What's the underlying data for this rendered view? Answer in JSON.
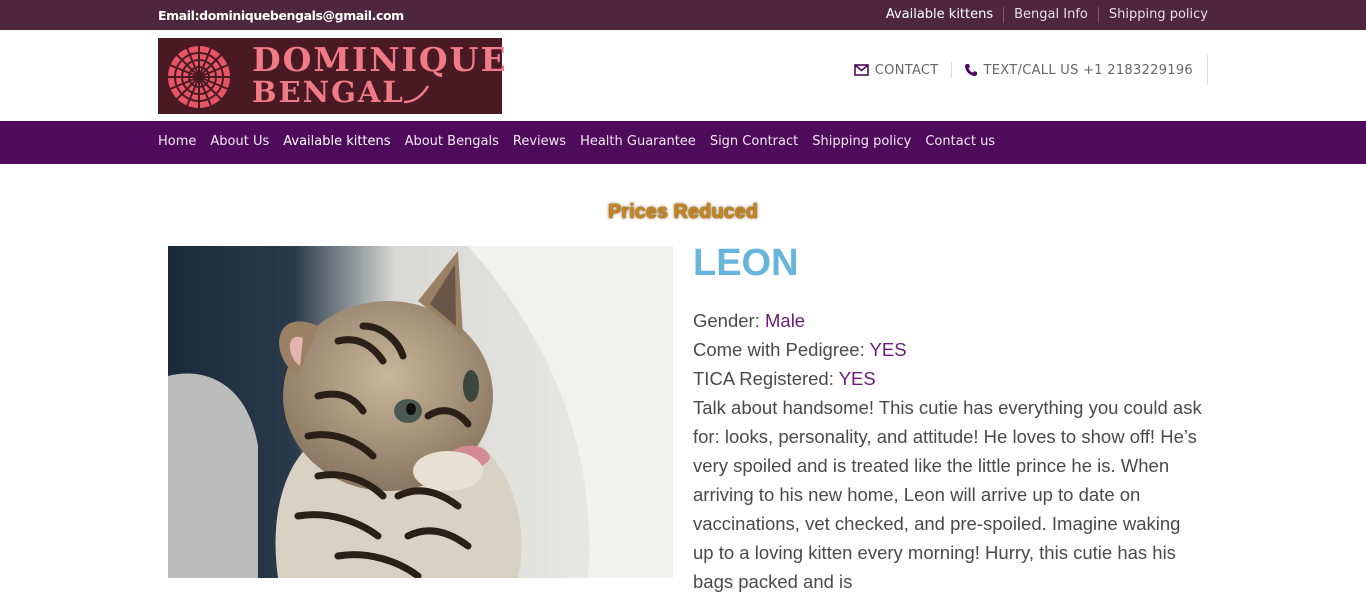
{
  "topbar": {
    "email": "Email:dominiquebengals@gmail.com",
    "links": [
      "Available kittens",
      "Bengal Info",
      "Shipping policy"
    ]
  },
  "logo": {
    "line1": "DOMINIQUE",
    "line2": "BENGAL"
  },
  "header": {
    "contact_label": "CONTACT",
    "call_label": "TEXT/CALL US +1 2183229196"
  },
  "nav": {
    "items": [
      "Home",
      "About Us",
      "Available kittens",
      "About Bengals",
      "Reviews",
      "Health Guarantee",
      "Sign Contract",
      "Shipping policy",
      "Contact us"
    ],
    "active": "Available kittens"
  },
  "main": {
    "banner": "Prices Reduced",
    "kitten_name": "LEON",
    "gender_label": "Gender:",
    "gender": "Male",
    "pedigree_label": "Come with Pedigree:",
    "pedigree": "YES",
    "tica_label": "TICA Registered:",
    "tica": "YES",
    "description": "Talk about handsome! This cutie has everything you could ask for: looks, personality, and attitude! He loves to show off! He’s very spoiled and is treated like the little prince he is. When arriving to his new home, Leon will arrive up to date on vaccinations, vet checked, and pre-spoiled. Imagine waking up to a loving kitten every morning! Hurry, this cutie has his bags packed and is"
  },
  "colors": {
    "topbar": "#4e2640",
    "nav": "#4f0a5b",
    "accent_value": "#6b1a78",
    "name": "#67b4dc",
    "banner": "#c8861a",
    "logo_bg": "#4a1a24",
    "logo_text": "#f07a86"
  },
  "icons": [
    "envelope-icon",
    "phone-icon",
    "logo-mandala-icon"
  ]
}
